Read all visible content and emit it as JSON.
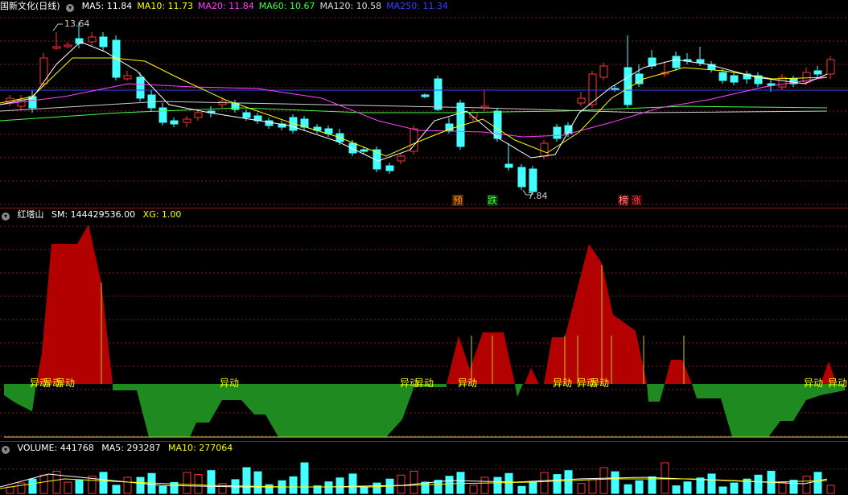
{
  "main": {
    "title": "国新文化(日线)",
    "ma": [
      {
        "label": "MA5: 11.84",
        "color": "#ffffff"
      },
      {
        "label": "MA10: 11.73",
        "color": "#ffff00"
      },
      {
        "label": "MA20: 11.84",
        "color": "#ff44ff"
      },
      {
        "label": "MA60: 10.67",
        "color": "#44ff44"
      },
      {
        "label": "MA120: 10.58",
        "color": "#dddddd"
      },
      {
        "label": "MA250: 11.34",
        "color": "#3344ff"
      }
    ],
    "high_label": "13.64",
    "low_label": "7.84",
    "tags": [
      {
        "text": "预",
        "color": "#ff9900",
        "bg": "#4a2000"
      },
      {
        "text": "跌",
        "color": "#44ff44",
        "bg": "#003300"
      },
      {
        "text": "榜",
        "color": "#ff9999",
        "bg": "#5a0000"
      },
      {
        "text": "涨",
        "color": "#ff4444",
        "bg": "#3a0000"
      }
    ]
  },
  "indicator": {
    "name": "红塔山",
    "sm_label": "SM: 144429536.00",
    "xg_label": "XG: 1.00",
    "signal_text": "异动",
    "signal_color": "#ffff00"
  },
  "volume": {
    "vol_label": "VOLUME: 441768",
    "ma5_label": "MA5: 293287",
    "ma10_label": "MA10: 277064"
  },
  "colors": {
    "up": "#ff3333",
    "down": "#44ffff",
    "grid": "#8a1a1a",
    "ind_up": "#b30000",
    "ind_down": "#1f8a1f"
  }
}
